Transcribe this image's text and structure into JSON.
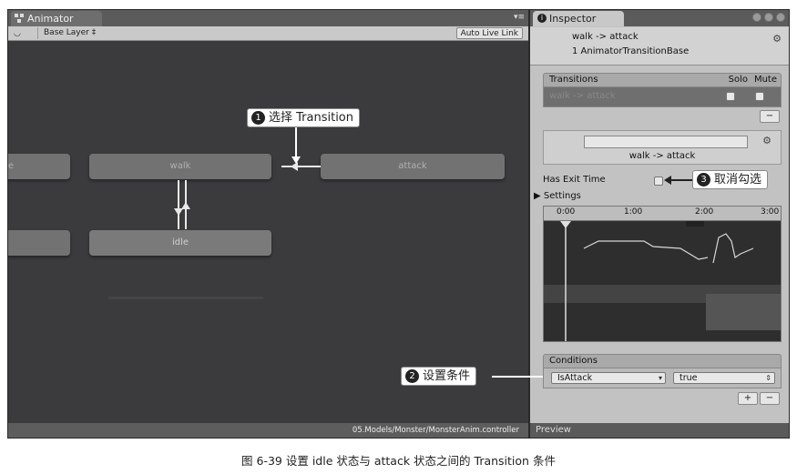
{
  "animator": {
    "tab_title": "Animator",
    "layer_selector": "Base Layer ‡",
    "auto_live_link": "Auto Live Link",
    "nodes": {
      "left_upper_partial": "tte",
      "walk": "walk",
      "attack": "attack",
      "idle": "idle"
    },
    "controller_path": "05.Models/Monster/MonsterAnim.controller"
  },
  "inspector": {
    "tab_title": "Inspector",
    "title": "walk -> attack",
    "subtitle": "1 AnimatorTransitionBase",
    "transitions": {
      "header": "Transitions",
      "solo": "Solo",
      "mute": "Mute",
      "row_label": "walk -> attack",
      "remove_btn": "−"
    },
    "transition_name": "walk -> attack",
    "has_exit_time": "Has Exit Time",
    "settings": "Settings",
    "timeline_ticks": [
      "0:00",
      "1:00",
      "2:00",
      "3:00"
    ],
    "conditions": {
      "header": "Conditions",
      "parameter": "IsAttack",
      "value": "true",
      "add_btn": "+",
      "remove_btn": "−"
    },
    "preview_label": "Preview"
  },
  "callouts": {
    "c1": {
      "num": "1",
      "text": "选择 Transition"
    },
    "c2": {
      "num": "2",
      "text": "设置条件"
    },
    "c3": {
      "num": "3",
      "text": "取消勾选"
    }
  },
  "caption": "图 6-39   设置 idle 状态与 attack 状态之间的 Transition 条件"
}
